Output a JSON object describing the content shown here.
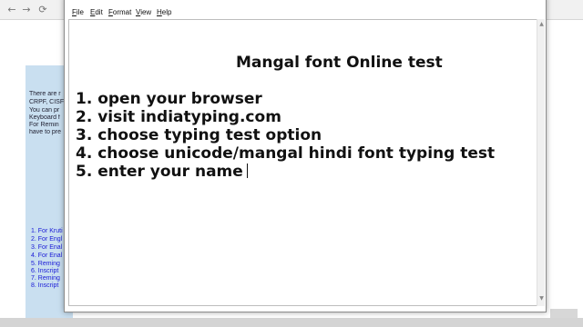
{
  "browser": {
    "back_icon": "back-arrow-icon",
    "forward_icon": "forward-arrow-icon",
    "sidebar_text": [
      "There are r",
      "CRPF, CISF",
      "You can pr",
      "Keyboard f",
      "For Remin",
      "have to pre"
    ],
    "links": [
      "1. For Kruti",
      "2. For Engl",
      "3. For Enal",
      "4. For Enal",
      "5. Reming",
      "6. Inscript",
      "7. Reming",
      "8. Inscript"
    ]
  },
  "notepad": {
    "menu": [
      "File",
      "Edit",
      "Format",
      "View",
      "Help"
    ],
    "content": {
      "title": "Mangal font Online test",
      "lines": [
        "1. open your browser",
        "2. visit indiatyping.com",
        "3. choose typing test option",
        "4. choose unicode/mangal hindi font typing test",
        "5. enter your name"
      ]
    }
  }
}
